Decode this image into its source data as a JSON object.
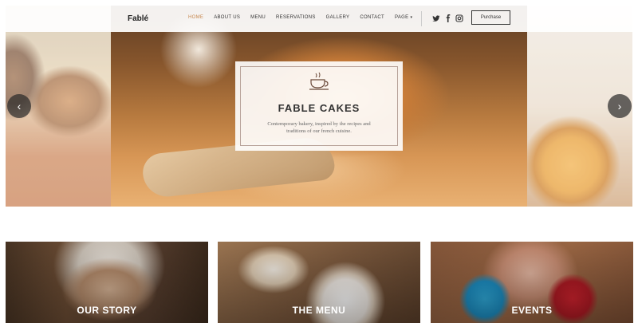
{
  "navbar": {
    "logo": "Fablé",
    "menu": [
      {
        "label": "HOME",
        "active": true
      },
      {
        "label": "ABOUT US",
        "active": false
      },
      {
        "label": "MENU",
        "active": false
      },
      {
        "label": "RESERVATIONS",
        "active": false
      },
      {
        "label": "GALLERY",
        "active": false
      },
      {
        "label": "CONTACT",
        "active": false
      },
      {
        "label": "PAGE",
        "active": false,
        "has_dropdown": true
      }
    ],
    "social_icons": [
      "twitter-icon",
      "facebook-icon",
      "instagram-icon"
    ],
    "purchase_label": "Purchase",
    "accent_color": "#c6874e"
  },
  "hero": {
    "title": "FABLE CAKES",
    "text": "Contemporary bakery, inspired by the recipes and traditions of our french cuisine.",
    "icon": "coffee-cup-icon",
    "prev_icon": "chevron-left-icon",
    "next_icon": "chevron-right-icon"
  },
  "tiles": [
    {
      "label": "OUR STORY"
    },
    {
      "label": "THE MENU"
    },
    {
      "label": "EVENTS"
    }
  ]
}
